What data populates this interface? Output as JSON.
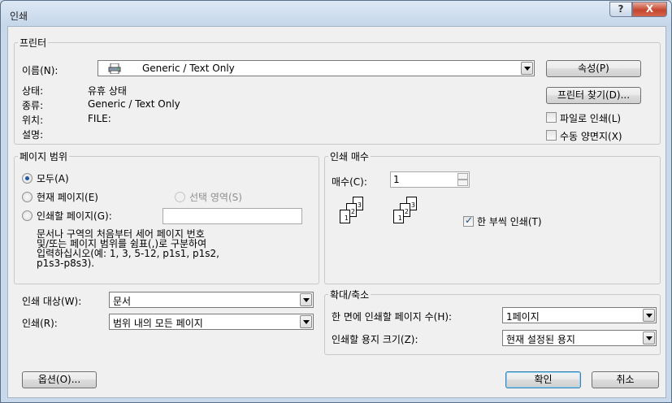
{
  "window": {
    "title": "인쇄",
    "help_glyph": "?",
    "close_glyph": "X"
  },
  "printer": {
    "legend": "프린터",
    "name_label": "이름(N):",
    "name_value": "Generic / Text Only",
    "status_label": "상태:",
    "status_value": "유휴 상태",
    "type_label": "종류:",
    "type_value": "Generic / Text Only",
    "where_label": "위치:",
    "where_value": "FILE:",
    "comment_label": "설명:",
    "properties_button": "속성(P)",
    "find_printer_button": "프린터 찾기(D)...",
    "print_to_file_label": "파일로 인쇄(L)",
    "print_to_file_checked": false,
    "manual_duplex_label": "수동 양면지(X)",
    "manual_duplex_checked": false
  },
  "page_range": {
    "legend": "페이지 범위",
    "all_label": "모두(A)",
    "current_label": "현재 페이지(E)",
    "selection_label": "선택 영역(S)",
    "pages_label": "인쇄할 페이지(G):",
    "pages_value": "",
    "selected": "all",
    "hint_lines": [
      "문서나 구역의 처음부터 세어 페이지 번호",
      "및/또는 페이지 범위를 쉼표(,)로 구분하여",
      "입력하십시오(예: 1, 3, 5-12, p1s1, p1s2,",
      "p1s3-p8s3)."
    ]
  },
  "copies": {
    "legend": "인쇄 매수",
    "count_label": "매수(C):",
    "count_value": "1",
    "collate_label": "한 부씩 인쇄(T)",
    "collate_checked": true,
    "collate_pages": [
      "1",
      "2",
      "3"
    ]
  },
  "print_what": {
    "label": "인쇄 대상(W):",
    "value": "문서"
  },
  "print_range": {
    "label": "인쇄(R):",
    "value": "범위 내의 모든 페이지"
  },
  "zoom": {
    "legend": "확대/축소",
    "pages_per_sheet_label": "한 면에 인쇄할 페이지 수(H):",
    "pages_per_sheet_value": "1페이지",
    "scale_label": "인쇄할 용지 크기(Z):",
    "scale_value": "현재 설정된 용지"
  },
  "footer": {
    "options_button": "옵션(O)...",
    "ok_button": "확인",
    "cancel_button": "취소"
  },
  "icons": [
    "printer-icon",
    "help-icon",
    "close-icon",
    "spin-up-icon",
    "spin-down-icon",
    "chevron-down-icon"
  ]
}
